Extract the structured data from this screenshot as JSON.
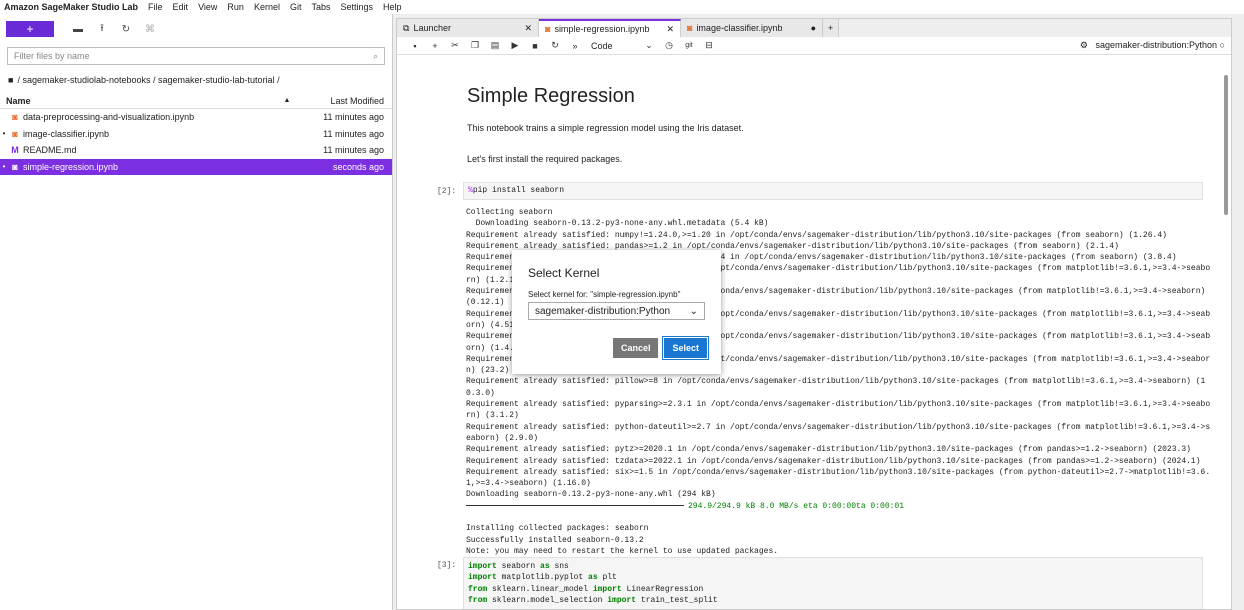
{
  "menubar": {
    "brand": "Amazon SageMaker Studio Lab",
    "items": [
      "File",
      "Edit",
      "View",
      "Run",
      "Kernel",
      "Git",
      "Tabs",
      "Settings",
      "Help"
    ]
  },
  "filebrowser": {
    "new_label": "+",
    "filter_placeholder": "Filter files by name",
    "breadcrumb": "/ sagemaker-studiolab-notebooks / sagemaker-studio-lab-tutorial /",
    "col_name": "Name",
    "col_modified": "Last Modified",
    "files": [
      {
        "name": "data-preprocessing-and-visualization.ipynb",
        "modified": "11 minutes ago",
        "icon": "notebook-icon",
        "running": false
      },
      {
        "name": "image-classifier.ipynb",
        "modified": "11 minutes ago",
        "icon": "notebook-icon",
        "running": true
      },
      {
        "name": "README.md",
        "modified": "11 minutes ago",
        "icon": "markdown-icon",
        "running": false
      },
      {
        "name": "simple-regression.ipynb",
        "modified": "seconds ago",
        "icon": "notebook-icon",
        "running": true
      }
    ]
  },
  "tabs": [
    {
      "label": "Launcher",
      "icon": "launcher-icon",
      "active": false,
      "close": "✕"
    },
    {
      "label": "simple-regression.ipynb",
      "icon": "notebook-icon",
      "active": true,
      "close": "✕"
    },
    {
      "label": "image-classifier.ipynb",
      "icon": "notebook-icon",
      "active": false,
      "close": "●"
    }
  ],
  "notebook_toolbar": {
    "cell_type": "Code",
    "kernel": "sagemaker-distribution:Python"
  },
  "notebook": {
    "title": "Simple Regression",
    "p1": "This notebook trains a simple regression model using the Iris dataset.",
    "p2": "Let's first install the required packages.",
    "cell1_prompt": "[2]:",
    "cell1_magic": "%",
    "cell1_code": "pip install seaborn",
    "cell1_output": "Collecting seaborn\n  Downloading seaborn-0.13.2-py3-none-any.whl.metadata (5.4 kB)\nRequirement already satisfied: numpy!=1.24.0,>=1.20 in /opt/conda/envs/sagemaker-distribution/lib/python3.10/site-packages (from seaborn) (1.26.4)\nRequirement already satisfied: pandas>=1.2 in /opt/conda/envs/sagemaker-distribution/lib/python3.10/site-packages (from seaborn) (2.1.4)\nRequirement already satisfied: matplotlib!=3.6.1,>=3.4 in /opt/conda/envs/sagemaker-distribution/lib/python3.10/site-packages (from seaborn) (3.8.4)\nRequirement already satisfied: contourpy>=1.0.1 in /opt/conda/envs/sagemaker-distribution/lib/python3.10/site-packages (from matplotlib!=3.6.1,>=3.4->seabo\nrn) (1.2.1)\nRequirement already satisfied: cycler>=0.10 in /opt/conda/envs/sagemaker-distribution/lib/python3.10/site-packages (from matplotlib!=3.6.1,>=3.4->seaborn)\n(0.12.1)\nRequirement already satisfied: fonttools>=4.22.0 in /opt/conda/envs/sagemaker-distribution/lib/python3.10/site-packages (from matplotlib!=3.6.1,>=3.4->seab\norn) (4.51.0)\nRequirement already satisfied: kiwisolver>=1.3.1 in /opt/conda/envs/sagemaker-distribution/lib/python3.10/site-packages (from matplotlib!=3.6.1,>=3.4->seab\norn) (1.4.5)\nRequirement already satisfied: packaging>=20.0 in /opt/conda/envs/sagemaker-distribution/lib/python3.10/site-packages (from matplotlib!=3.6.1,>=3.4->seabor\nn) (23.2)\nRequirement already satisfied: pillow>=8 in /opt/conda/envs/sagemaker-distribution/lib/python3.10/site-packages (from matplotlib!=3.6.1,>=3.4->seaborn) (1\n0.3.0)\nRequirement already satisfied: pyparsing>=2.3.1 in /opt/conda/envs/sagemaker-distribution/lib/python3.10/site-packages (from matplotlib!=3.6.1,>=3.4->seabo\nrn) (3.1.2)\nRequirement already satisfied: python-dateutil>=2.7 in /opt/conda/envs/sagemaker-distribution/lib/python3.10/site-packages (from matplotlib!=3.6.1,>=3.4->s\neaborn) (2.9.0)\nRequirement already satisfied: pytz>=2020.1 in /opt/conda/envs/sagemaker-distribution/lib/python3.10/site-packages (from pandas>=1.2->seaborn) (2023.3)\nRequirement already satisfied: tzdata>=2022.1 in /opt/conda/envs/sagemaker-distribution/lib/python3.10/site-packages (from pandas>=1.2->seaborn) (2024.1)\nRequirement already satisfied: six>=1.5 in /opt/conda/envs/sagemaker-distribution/lib/python3.10/site-packages (from python-dateutil>=2.7->matplotlib!=3.6.\n1,>=3.4->seaborn) (1.16.0)\nDownloading seaborn-0.13.2-py3-none-any.whl (294 kB)",
    "progress_text": "294.9/294.9 kB 8.0 MB/s eta 0:00:00ta 0:00:01",
    "cell1_output2": "Installing collected packages: seaborn\nSuccessfully installed seaborn-0.13.2\nNote: you may need to restart the kernel to use updated packages.",
    "cell2_prompt": "[3]:",
    "cell2_lines": [
      [
        "import",
        " seaborn ",
        "as",
        " sns"
      ],
      [
        "import",
        " matplotlib.pyplot ",
        "as",
        " plt"
      ],
      [
        "from",
        " sklearn.linear_model ",
        "import",
        " LinearRegression"
      ],
      [
        "from",
        " sklearn.model_selection ",
        "import",
        " train_test_split"
      ]
    ]
  },
  "dialog": {
    "title": "Select Kernel",
    "label": "Select kernel for: \"simple-regression.ipynb\"",
    "selected": "sagemaker-distribution:Python",
    "cancel": "Cancel",
    "select": "Select"
  },
  "colors": {
    "accent": "#7b2fe0",
    "primary_button": "#1976d2"
  }
}
